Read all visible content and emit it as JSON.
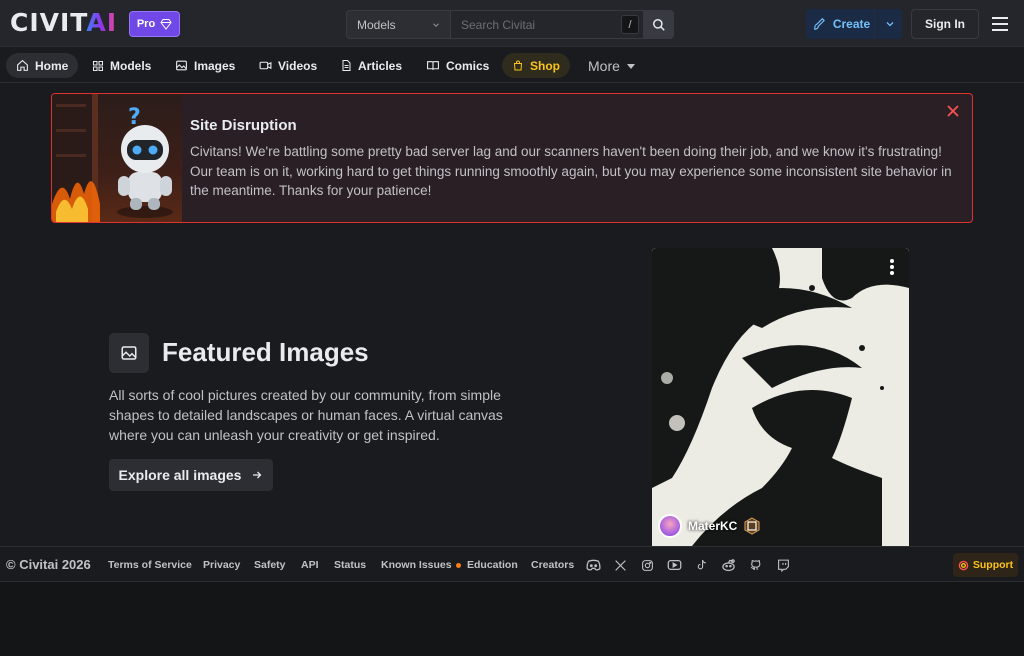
{
  "header": {
    "logo": "CIVITAI",
    "pro_label": "Pro",
    "search": {
      "category": "Models",
      "placeholder": "Search Civitai",
      "shortcut": "/"
    },
    "create_label": "Create",
    "signin_label": "Sign In"
  },
  "nav": {
    "items": [
      {
        "label": "Home",
        "icon": "home-icon"
      },
      {
        "label": "Models",
        "icon": "grid-icon"
      },
      {
        "label": "Images",
        "icon": "photo-icon"
      },
      {
        "label": "Videos",
        "icon": "video-icon"
      },
      {
        "label": "Articles",
        "icon": "file-text-icon"
      },
      {
        "label": "Comics",
        "icon": "book-icon"
      },
      {
        "label": "Shop",
        "icon": "shopping-bag-icon"
      },
      {
        "label": "More",
        "icon": "caret-down-icon"
      }
    ]
  },
  "alert": {
    "title": "Site Disruption",
    "body": "Civitans! We're battling some pretty bad server lag and our scanners haven't been doing their job, and we know it's frustrating! Our team is on it, working hard to get things running smoothly again, but you may experience some inconsistent site behavior in the meantime. Thanks for your patience!"
  },
  "featured": {
    "title": "Featured Images",
    "description": "All sorts of cool pictures created by our community, from simple shapes to detailed landscapes or human faces. A virtual canvas where you can unleash your creativity or get inspired.",
    "button": "Explore all images",
    "card": {
      "username": "MaterKC"
    }
  },
  "footer": {
    "copyright": "© Civitai 2026",
    "links": [
      "Terms of Service",
      "Privacy",
      "Safety",
      "API",
      "Status",
      "Known Issues",
      "Education",
      "Creators"
    ],
    "support": "Support"
  },
  "colors": {
    "accent_pro": "#7048e8",
    "shop": "#fcc419",
    "alert_border": "#e03131",
    "create": "#74c0fc"
  }
}
